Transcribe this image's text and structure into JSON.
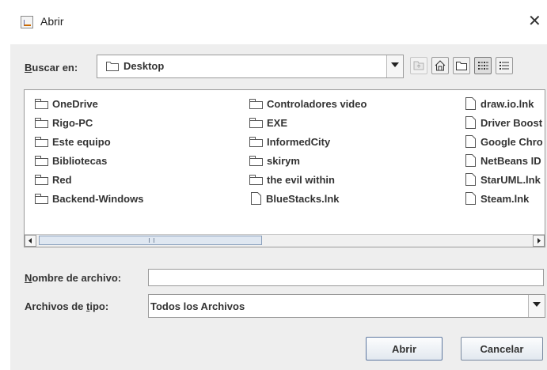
{
  "window": {
    "title": "Abrir",
    "close_symbol": "✕"
  },
  "lookin": {
    "label": "Buscar en:",
    "mnemonic": "B",
    "label_rest": "uscar en:",
    "value": "Desktop"
  },
  "toolbar": [
    {
      "name": "up-folder-button",
      "icon": "up-folder-icon",
      "disabled": true
    },
    {
      "name": "home-button",
      "icon": "home-icon",
      "disabled": false
    },
    {
      "name": "new-folder-button",
      "icon": "new-folder-icon",
      "disabled": false
    },
    {
      "name": "list-view-button",
      "icon": "list-view-icon",
      "pressed": true
    },
    {
      "name": "details-view-button",
      "icon": "details-view-icon",
      "pressed": false
    }
  ],
  "files": [
    [
      {
        "name": "OneDrive",
        "type": "folder"
      },
      {
        "name": "Rigo-PC",
        "type": "folder"
      },
      {
        "name": "Este equipo",
        "type": "folder"
      },
      {
        "name": "Bibliotecas",
        "type": "folder"
      },
      {
        "name": "Red",
        "type": "folder"
      },
      {
        "name": "Backend-Windows",
        "type": "folder"
      }
    ],
    [
      {
        "name": "Controladores video",
        "type": "folder"
      },
      {
        "name": "EXE",
        "type": "folder"
      },
      {
        "name": "InformedCity",
        "type": "folder"
      },
      {
        "name": "skirym",
        "type": "folder"
      },
      {
        "name": "the evil within",
        "type": "folder"
      },
      {
        "name": "BlueStacks.lnk",
        "type": "file"
      }
    ],
    [
      {
        "name": "draw.io.lnk",
        "type": "file"
      },
      {
        "name": "Driver Boost",
        "type": "file"
      },
      {
        "name": "Google Chro",
        "type": "file"
      },
      {
        "name": "NetBeans ID",
        "type": "file"
      },
      {
        "name": "StarUML.lnk",
        "type": "file"
      },
      {
        "name": "Steam.lnk",
        "type": "file"
      }
    ]
  ],
  "scroll": {
    "left_symbol": "◀",
    "right_symbol": "▶",
    "thumb_fraction": 0.45
  },
  "filename": {
    "label": "Nombre de archivo:",
    "mnemonic": "N",
    "label_rest": "ombre de archivo:",
    "value": ""
  },
  "filetype": {
    "label_pre": "Archivos de ",
    "mnemonic": "t",
    "label_rest": "ipo:",
    "value": "Todos los Archivos"
  },
  "buttons": {
    "open": "Abrir",
    "cancel": "Cancelar"
  },
  "colors": {
    "dialog_bg": "#eeeeee",
    "thumb": "#dfe7f1",
    "border": "#9a9a9a"
  }
}
